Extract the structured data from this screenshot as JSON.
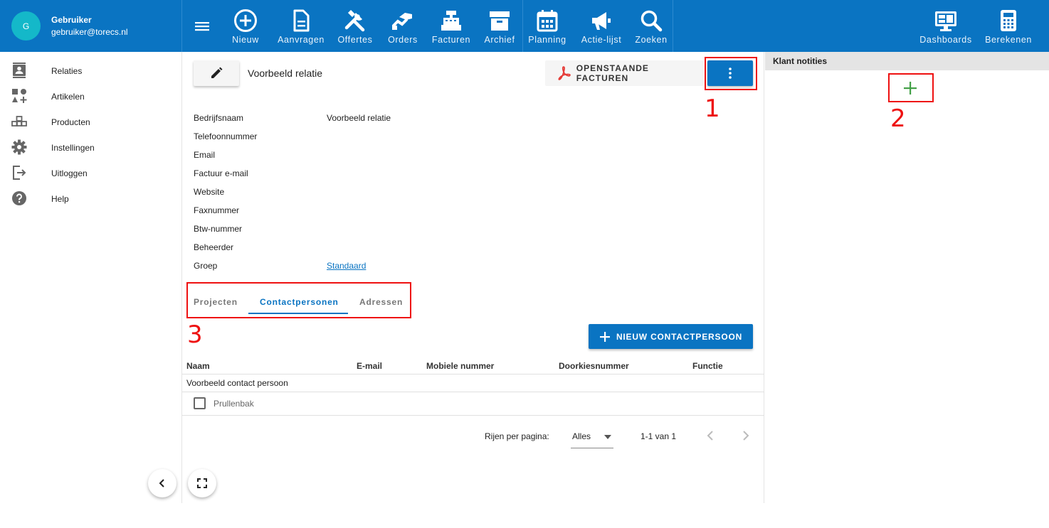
{
  "user": {
    "initial": "G",
    "name": "Gebruiker",
    "email": "gebruiker@torecs.nl"
  },
  "topnav": {
    "items": [
      {
        "label": "Nieuw",
        "icon": "plus-circle-icon"
      },
      {
        "label": "Aanvragen",
        "icon": "document-icon"
      },
      {
        "label": "Offertes",
        "icon": "tools-icon"
      },
      {
        "label": "Orders",
        "icon": "handshake-icon"
      },
      {
        "label": "Facturen",
        "icon": "cash-register-icon"
      },
      {
        "label": "Archief",
        "icon": "archive-icon"
      },
      {
        "label": "Planning",
        "icon": "calendar-icon"
      },
      {
        "label": "Actie-lijst",
        "icon": "megaphone-icon"
      },
      {
        "label": "Zoeken",
        "icon": "search-icon"
      }
    ],
    "right": [
      {
        "label": "Dashboards",
        "icon": "monitor-dashboard-icon"
      },
      {
        "label": "Berekenen",
        "icon": "calculator-icon"
      }
    ]
  },
  "sidebar": {
    "items": [
      {
        "label": "Relaties",
        "icon": "contacts-icon"
      },
      {
        "label": "Artikelen",
        "icon": "shapes-icon"
      },
      {
        "label": "Producten",
        "icon": "blocks-icon"
      },
      {
        "label": "Instellingen",
        "icon": "gear-icon"
      },
      {
        "label": "Uitloggen",
        "icon": "logout-icon"
      },
      {
        "label": "Help",
        "icon": "help-icon"
      }
    ]
  },
  "relation": {
    "title": "Voorbeeld relatie",
    "pdf_button": "OPENSTAANDE FACTUREN",
    "fields": [
      {
        "label": "Bedrijfsnaam",
        "value": "Voorbeeld relatie"
      },
      {
        "label": "Telefoonnummer",
        "value": ""
      },
      {
        "label": "Email",
        "value": ""
      },
      {
        "label": "Factuur e-mail",
        "value": ""
      },
      {
        "label": "Website",
        "value": ""
      },
      {
        "label": "Faxnummer",
        "value": ""
      },
      {
        "label": "Btw-nummer",
        "value": ""
      },
      {
        "label": "Beheerder",
        "value": ""
      },
      {
        "label": "Groep",
        "value": "Standaard"
      }
    ]
  },
  "tabs": {
    "items": [
      "Projecten",
      "Contactpersonen",
      "Adressen"
    ],
    "active": "Contactpersonen"
  },
  "contacts": {
    "new_button": "NIEUW CONTACTPERSOON",
    "columns": [
      "Naam",
      "E-mail",
      "Mobiele nummer",
      "Doorkiesnummer",
      "Functie"
    ],
    "rows": [
      [
        "Voorbeeld contact persoon",
        "",
        "",
        "",
        ""
      ]
    ],
    "trash_label": "Prullenbak"
  },
  "pagination": {
    "rows_label": "Rijen per pagina:",
    "rows_value": "Alles",
    "range": "1-1 van 1"
  },
  "notes": {
    "title": "Klant notities"
  },
  "annotations": [
    "1",
    "2",
    "3"
  ],
  "colors": {
    "primary": "#0a74c2",
    "annotation": "#ee1111",
    "add_green": "#43a047"
  }
}
